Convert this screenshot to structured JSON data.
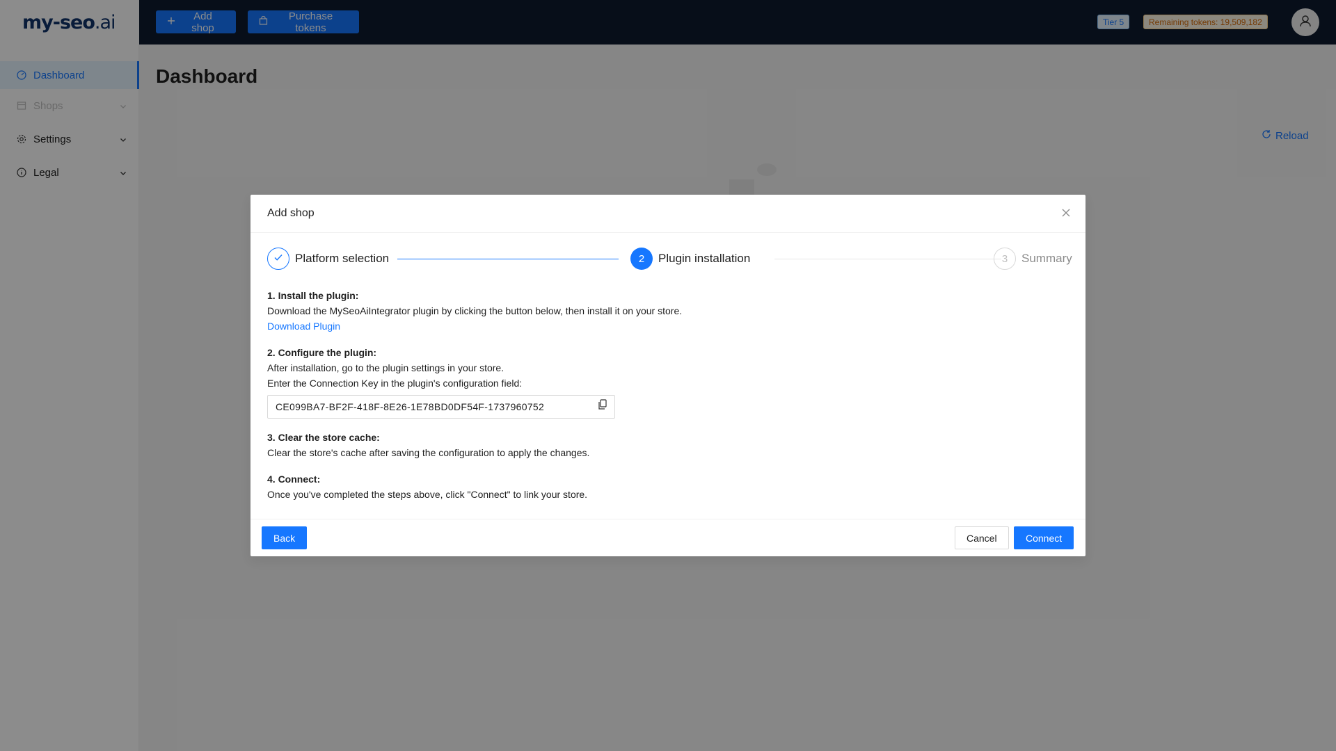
{
  "app": {
    "logo_text": "my-seo",
    "logo_suffix": ".ai"
  },
  "topbar": {
    "add_shop_label": "Add shop",
    "purchase_tokens_label": "Purchase tokens",
    "tier_label": "Tier 5",
    "remaining_tokens_label": "Remaining tokens: 19,509,182"
  },
  "sidebar": {
    "items": [
      {
        "label": "Dashboard",
        "icon": "dashboard-icon",
        "active": true
      },
      {
        "label": "Shops",
        "icon": "shop-icon",
        "disabled": true
      },
      {
        "label": "Settings",
        "icon": "gear-icon"
      },
      {
        "label": "Legal",
        "icon": "info-icon"
      }
    ]
  },
  "main": {
    "page_title": "Dashboard",
    "reload_label": "Reload"
  },
  "modal": {
    "title": "Add shop",
    "steps": [
      {
        "label": "Platform selection",
        "status": "finished"
      },
      {
        "number": "2",
        "label": "Plugin installation",
        "status": "current"
      },
      {
        "number": "3",
        "label": "Summary",
        "status": "waiting"
      }
    ],
    "sections": {
      "install_title": "1. Install the plugin:",
      "install_text": "Download the MySeoAiIntegrator plugin by clicking the button below, then install it on your store.",
      "download_link": "Download Plugin",
      "configure_title": "2. Configure the plugin:",
      "configure_text_1": "After installation, go to the plugin settings in your store.",
      "configure_text_2": "Enter the Connection Key in the plugin's configuration field:",
      "connection_key": "CE099BA7-BF2F-418F-8E26-1E78BD0DF54F-1737960752",
      "cache_title": "3. Clear the store cache:",
      "cache_text": "Clear the store's cache after saving the configuration to apply the changes.",
      "connect_title": "4. Connect:",
      "connect_text": "Once you've completed the steps above, click \"Connect\" to link your store."
    },
    "footer": {
      "back_label": "Back",
      "cancel_label": "Cancel",
      "connect_label": "Connect"
    }
  },
  "colors": {
    "primary": "#1677ff",
    "topbar_bg": "#0d1a2e",
    "tokens_badge": "#d46b08"
  }
}
